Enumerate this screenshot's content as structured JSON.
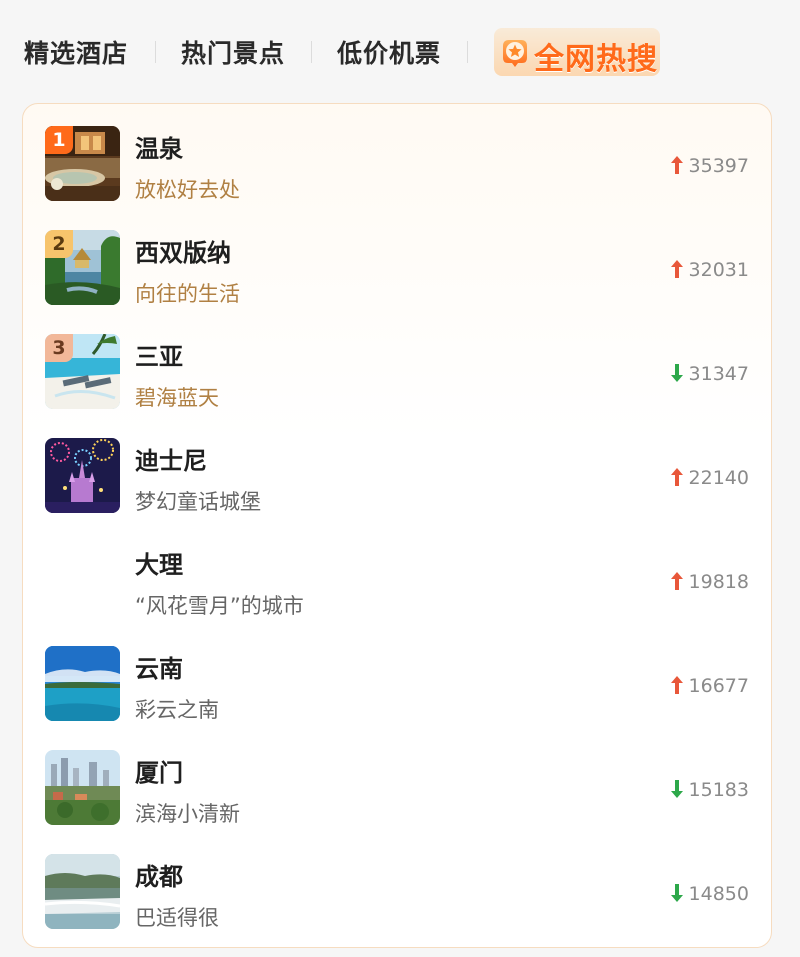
{
  "tabs": [
    {
      "label": "精选酒店"
    },
    {
      "label": "热门景点"
    },
    {
      "label": "低价机票"
    },
    {
      "label": "全网热搜",
      "active": true
    }
  ],
  "colors": {
    "accent": "#ff6a1a",
    "up": "#e8573a",
    "down": "#2da84a",
    "gold_text": "#b08043"
  },
  "list": [
    {
      "rank": "1",
      "name": "温泉",
      "desc": "放松好去处",
      "trend": "up",
      "score": "35397",
      "thumb": "hot-spring-photo"
    },
    {
      "rank": "2",
      "name": "西双版纳",
      "desc": "向往的生活",
      "trend": "up",
      "score": "32031",
      "thumb": "xishuangbanna-photo"
    },
    {
      "rank": "3",
      "name": "三亚",
      "desc": "碧海蓝天",
      "trend": "down",
      "score": "31347",
      "thumb": "sanya-beach-photo"
    },
    {
      "name": "迪士尼",
      "desc": "梦幻童话城堡",
      "trend": "up",
      "score": "22140",
      "thumb": "disney-castle-photo"
    },
    {
      "name": "大理",
      "desc": "“风花雪月”的城市",
      "trend": "up",
      "score": "19818",
      "thumb": ""
    },
    {
      "name": "云南",
      "desc": "彩云之南",
      "trend": "up",
      "score": "16677",
      "thumb": "yunnan-lake-photo"
    },
    {
      "name": "厦门",
      "desc": "滨海小清新",
      "trend": "down",
      "score": "15183",
      "thumb": "xiamen-city-photo"
    },
    {
      "name": "成都",
      "desc": "巴适得很",
      "trend": "down",
      "score": "14850",
      "thumb": "chengdu-photo"
    }
  ]
}
